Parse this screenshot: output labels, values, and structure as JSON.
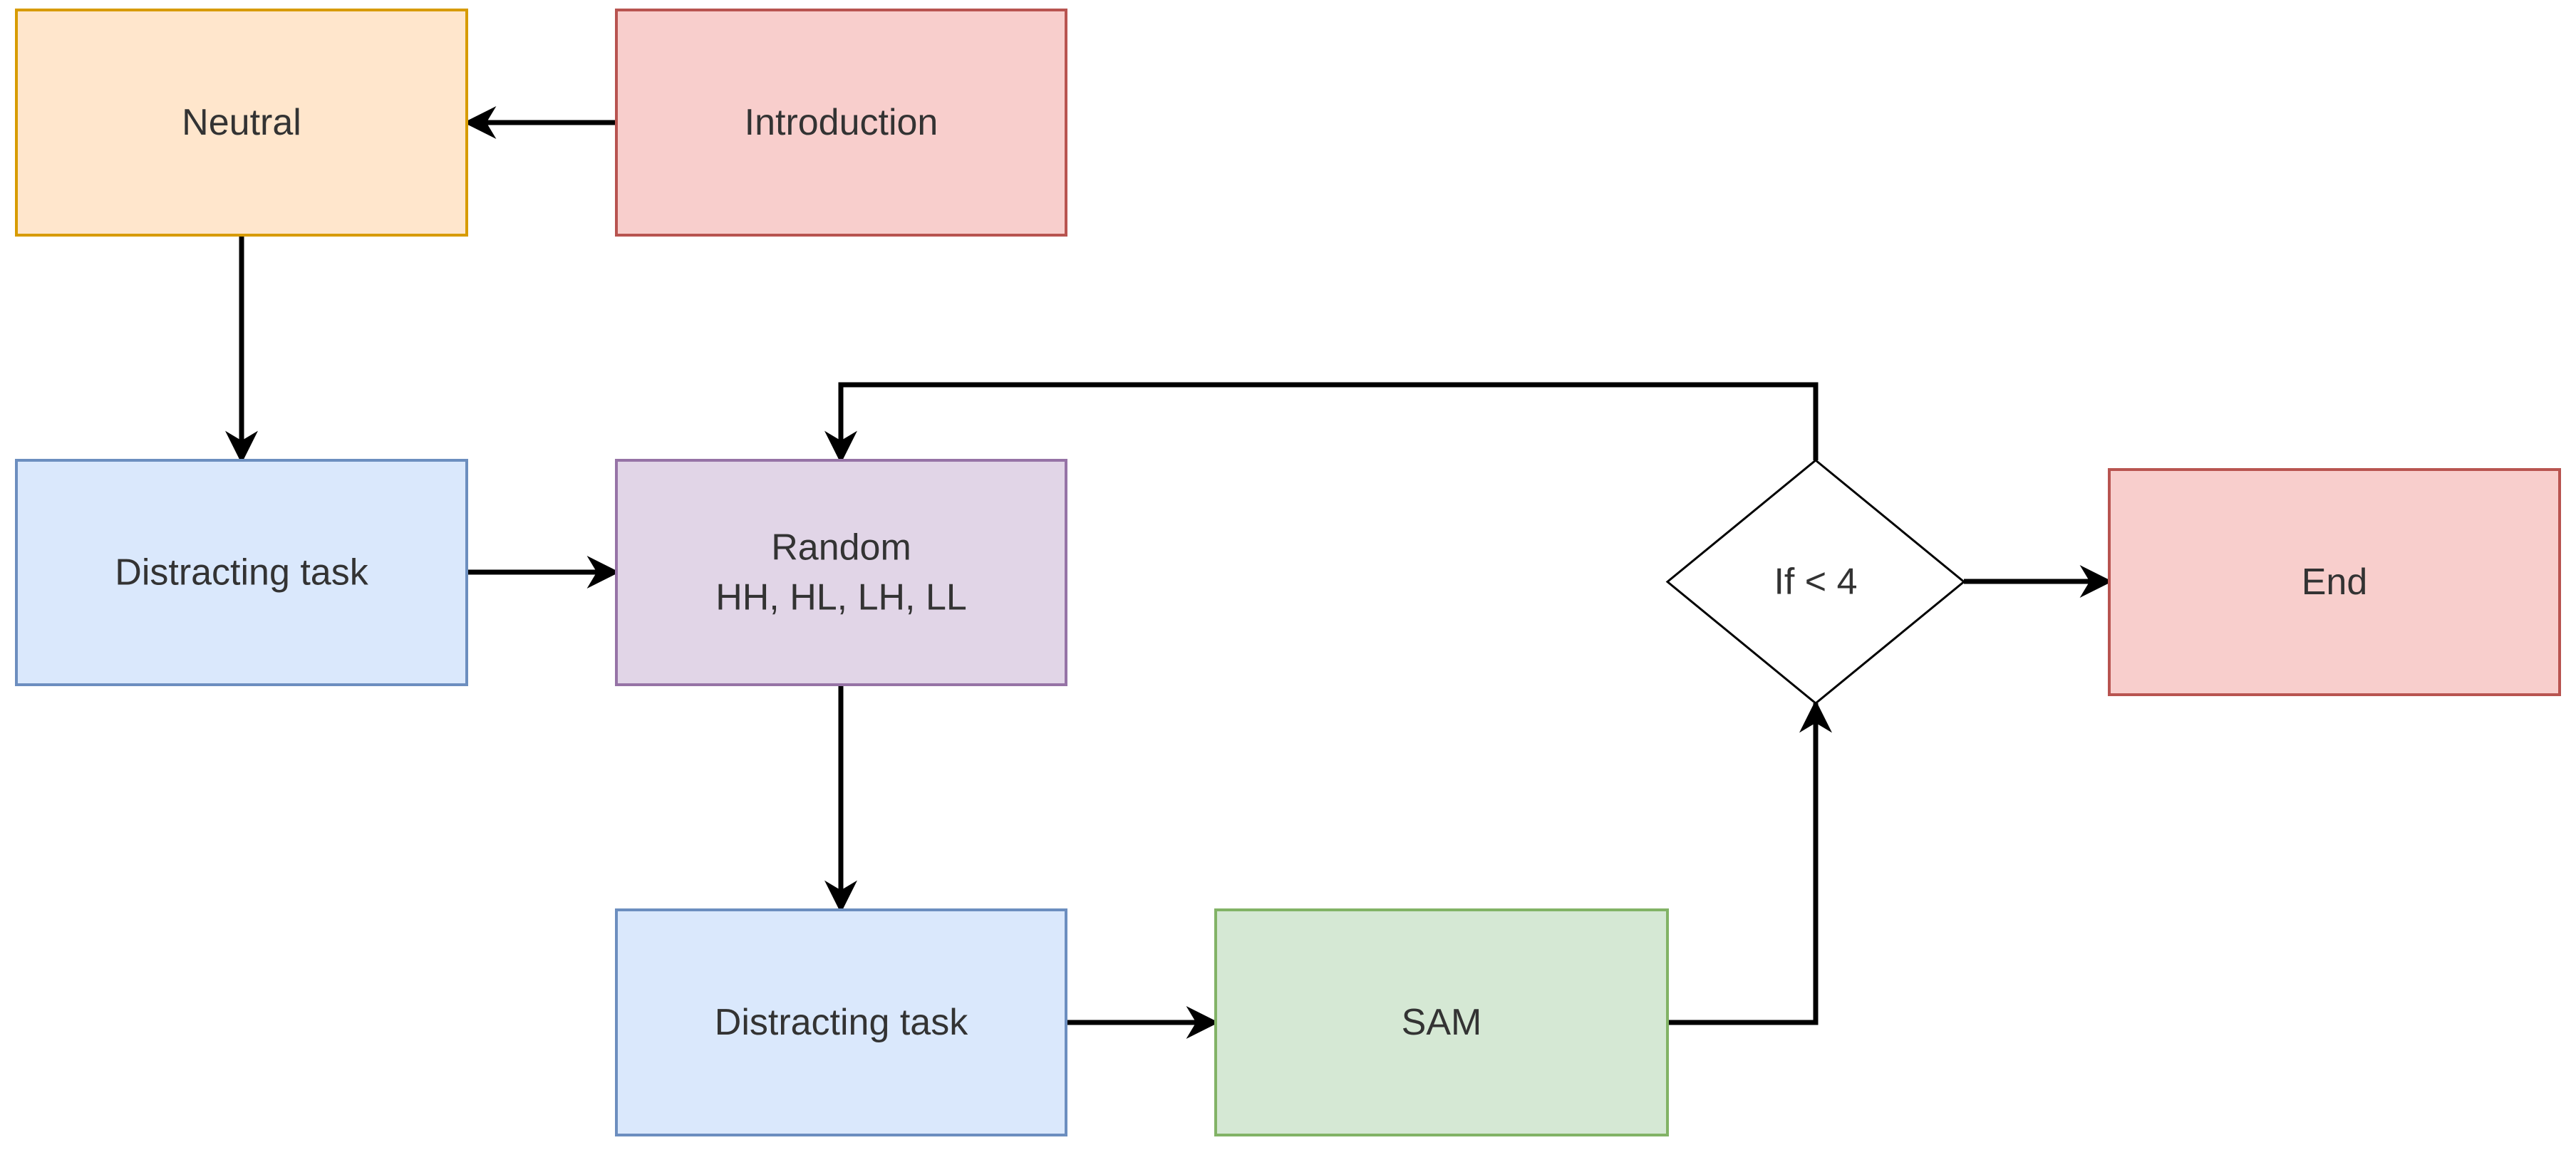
{
  "diagram": {
    "type": "flowchart",
    "nodes": [
      {
        "id": "introduction",
        "label": [
          "Introduction"
        ],
        "shape": "rect",
        "fill": "#f8cecc",
        "stroke": "#b85450"
      },
      {
        "id": "neutral",
        "label": [
          "Neutral"
        ],
        "shape": "rect",
        "fill": "#ffe6cc",
        "stroke": "#d79b00"
      },
      {
        "id": "distracting-task-1",
        "label": [
          "Distracting task"
        ],
        "shape": "rect",
        "fill": "#dae8fc",
        "stroke": "#6c8ebf"
      },
      {
        "id": "random",
        "label": [
          "Random",
          "HH, HL, LH, LL"
        ],
        "shape": "rect",
        "fill": "#e1d5e7",
        "stroke": "#9673a6"
      },
      {
        "id": "distracting-task-2",
        "label": [
          "Distracting task"
        ],
        "shape": "rect",
        "fill": "#dae8fc",
        "stroke": "#6c8ebf"
      },
      {
        "id": "sam",
        "label": [
          "SAM"
        ],
        "shape": "rect",
        "fill": "#d5e8d4",
        "stroke": "#82b366"
      },
      {
        "id": "decision",
        "label": [
          "If < 4"
        ],
        "shape": "diamond",
        "fill": "#ffffff",
        "stroke": "#000000"
      },
      {
        "id": "end",
        "label": [
          "End"
        ],
        "shape": "rect",
        "fill": "#f8cecc",
        "stroke": "#b85450"
      }
    ],
    "edges": [
      {
        "from": "introduction",
        "to": "neutral"
      },
      {
        "from": "neutral",
        "to": "distracting-task-1"
      },
      {
        "from": "distracting-task-1",
        "to": "random"
      },
      {
        "from": "random",
        "to": "distracting-task-2"
      },
      {
        "from": "distracting-task-2",
        "to": "sam"
      },
      {
        "from": "sam",
        "to": "decision"
      },
      {
        "from": "decision",
        "to": "random"
      },
      {
        "from": "decision",
        "to": "end"
      }
    ],
    "edge_color": "#000000"
  }
}
